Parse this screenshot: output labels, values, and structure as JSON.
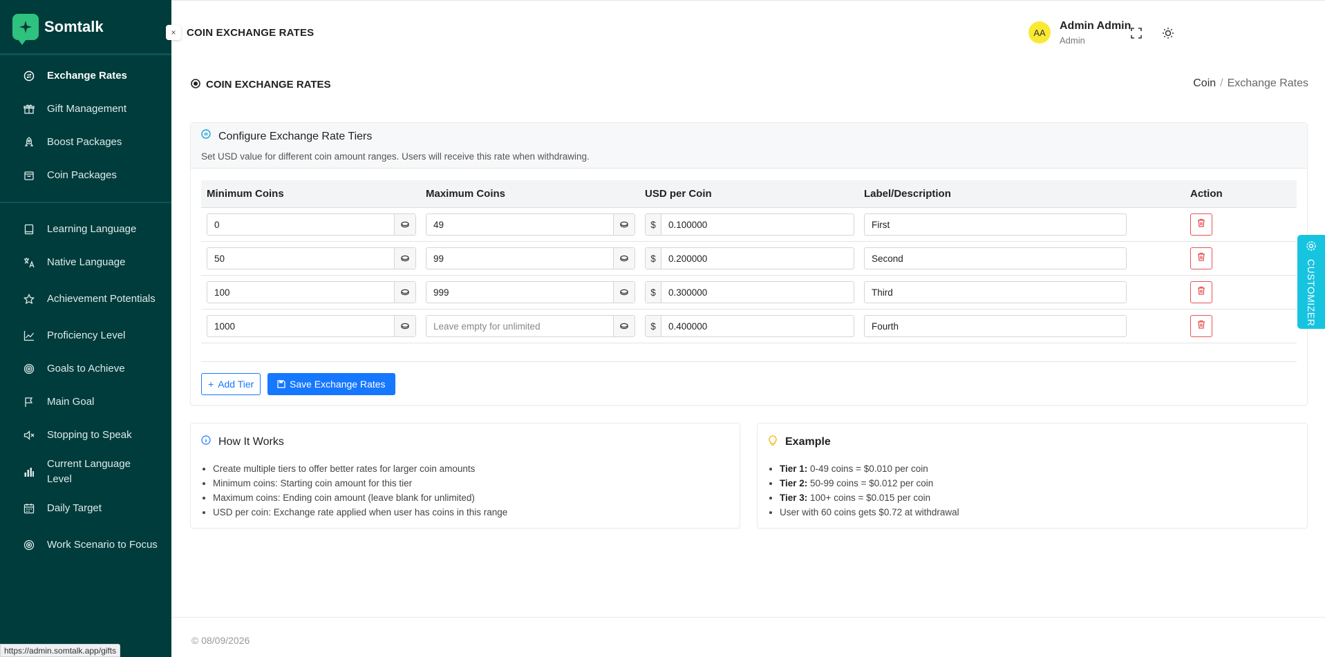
{
  "app": {
    "name": "Somtalk"
  },
  "sidebar": {
    "group1": [
      {
        "label": "Exchange Rates",
        "icon": "exchange-icon",
        "active": true
      },
      {
        "label": "Gift Management",
        "icon": "gift-icon"
      },
      {
        "label": "Boost Packages",
        "icon": "rocket-icon"
      },
      {
        "label": "Coin Packages",
        "icon": "bag-icon"
      }
    ],
    "group2": [
      {
        "label": "Learning Language",
        "icon": "book-icon"
      },
      {
        "label": "Native Language",
        "icon": "translate-icon"
      },
      {
        "label": "Achievement Potentials",
        "icon": "star-icon"
      },
      {
        "label": "Proficiency Level",
        "icon": "chart-line-icon"
      },
      {
        "label": "Goals to Achieve",
        "icon": "target-icon"
      },
      {
        "label": "Main Goal",
        "icon": "flag-icon"
      },
      {
        "label": "Stopping to Speak",
        "icon": "mute-icon"
      },
      {
        "label": "Current Language Level",
        "icon": "bar-chart-icon"
      },
      {
        "label": "Daily Target",
        "icon": "calendar-icon"
      },
      {
        "label": "Work Scenario to Focus",
        "icon": "focus-icon"
      }
    ]
  },
  "header": {
    "title": "COIN EXCHANGE RATES",
    "user": {
      "initials": "AA",
      "name": "Admin Admin",
      "role": "Admin"
    }
  },
  "page": {
    "title": "COIN EXCHANGE RATES",
    "breadcrumb": {
      "parent": "Coin",
      "current": "Exchange Rates"
    }
  },
  "config": {
    "title": "Configure Exchange Rate Tiers",
    "description": "Set USD value for different coin amount ranges. Users will receive this rate when withdrawing.",
    "columns": {
      "min": "Minimum Coins",
      "max": "Maximum Coins",
      "usd": "USD per Coin",
      "label": "Label/Description",
      "action": "Action"
    },
    "currency_symbol": "$",
    "max_placeholder": "Leave empty for unlimited",
    "rows": [
      {
        "min": "0",
        "max": "49",
        "usd": "0.100000",
        "label": "First"
      },
      {
        "min": "50",
        "max": "99",
        "usd": "0.200000",
        "label": "Second"
      },
      {
        "min": "100",
        "max": "999",
        "usd": "0.300000",
        "label": "Third"
      },
      {
        "min": "1000",
        "max": "",
        "usd": "0.400000",
        "label": "Fourth"
      }
    ],
    "add_label": "Add Tier",
    "save_label": "Save Exchange Rates"
  },
  "how": {
    "title": "How It Works",
    "items": [
      "Create multiple tiers to offer better rates for larger coin amounts",
      "Minimum coins: Starting coin amount for this tier",
      "Maximum coins: Ending coin amount (leave blank for unlimited)",
      "USD per coin: Exchange rate applied when user has coins in this range"
    ]
  },
  "example": {
    "title": "Example",
    "items": [
      {
        "bold": "Tier 1:",
        "text": " 0-49 coins = $0.010 per coin"
      },
      {
        "bold": "Tier 2:",
        "text": " 50-99 coins = $0.012 per coin"
      },
      {
        "bold": "Tier 3:",
        "text": " 100+ coins = $0.015 per coin"
      },
      {
        "bold": "",
        "text": "User with 60 coins gets $0.72 at withdrawal"
      }
    ]
  },
  "customizer": {
    "label": "CUSTOMIZER"
  },
  "footer": {
    "text": "© 08/09/2026"
  },
  "statusbar": {
    "url": "https://admin.somtalk.app/gifts"
  },
  "colors": {
    "sidebar": "#003c3c",
    "primary": "#1677ff",
    "danger": "#e55353",
    "customizer": "#17c4e0",
    "brand": "#2ec27e"
  }
}
